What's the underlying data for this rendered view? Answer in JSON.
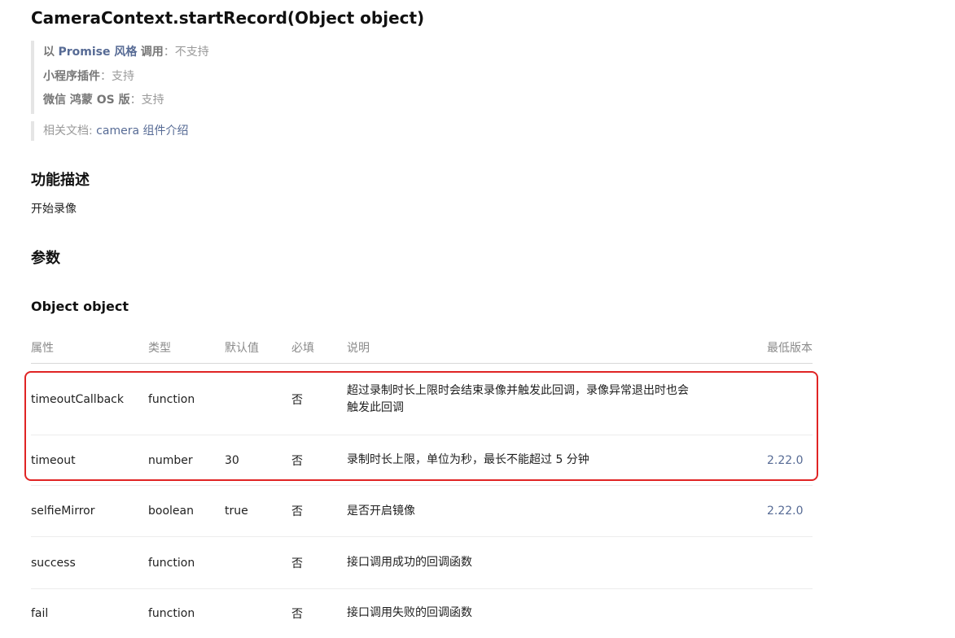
{
  "page": {
    "title": "CameraContext.startRecord(Object object)"
  },
  "support": {
    "promise": {
      "prefix": "以",
      "link": "Promise 风格",
      "label": "调用",
      "value": "不支持"
    },
    "plugin": {
      "label": "小程序插件",
      "value": "支持"
    },
    "harmony": {
      "label": "微信 鸿蒙 OS 版",
      "value": "支持"
    },
    "colon": "："
  },
  "related": {
    "label": "相关文档: ",
    "link": "camera 组件介绍"
  },
  "description": {
    "heading": "功能描述",
    "text": "开始录像"
  },
  "params": {
    "heading": "参数",
    "object_heading": "Object object",
    "columns": [
      "属性",
      "类型",
      "默认值",
      "必填",
      "说明",
      "最低版本"
    ],
    "rows": [
      {
        "name": "timeoutCallback",
        "type": "function",
        "default": "",
        "required": "否",
        "desc": "超过录制时长上限时会结束录像并触发此回调，录像异常退出时也会触发此回调",
        "version": ""
      },
      {
        "name": "timeout",
        "type": "number",
        "default": "30",
        "required": "否",
        "desc": "录制时长上限，单位为秒，最长不能超过 5 分钟",
        "version": "2.22.0"
      },
      {
        "name": "selfieMirror",
        "type": "boolean",
        "default": "true",
        "required": "否",
        "desc": "是否开启镜像",
        "version": "2.22.0"
      },
      {
        "name": "success",
        "type": "function",
        "default": "",
        "required": "否",
        "desc": "接口调用成功的回调函数",
        "version": ""
      },
      {
        "name": "fail",
        "type": "function",
        "default": "",
        "required": "否",
        "desc": "接口调用失败的回调函数",
        "version": ""
      }
    ]
  },
  "colors": {
    "link": "#576b95",
    "highlight_border": "#e02424"
  }
}
